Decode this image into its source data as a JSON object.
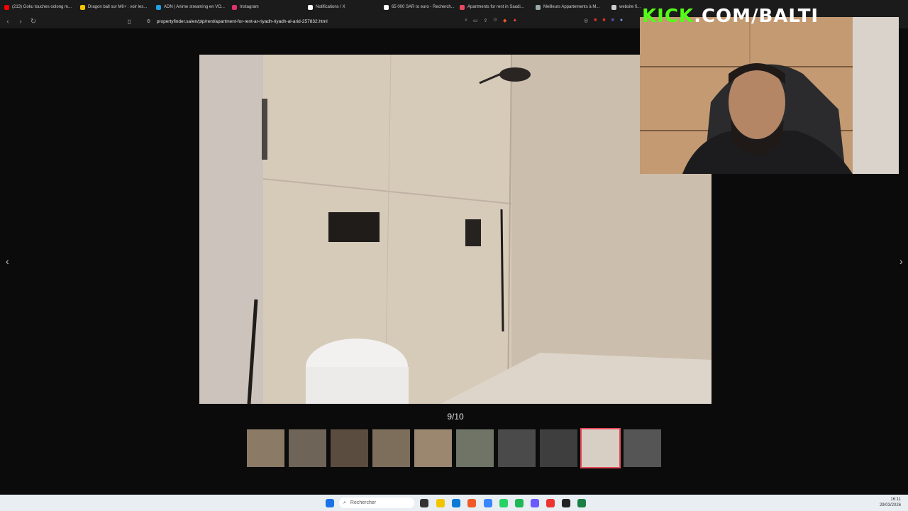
{
  "browser": {
    "tabs": [
      {
        "label": "(213) Goku touches oolong m...",
        "icon": "youtube-icon",
        "color": "#ff0000"
      },
      {
        "label": "Dragon ball sur M6+ : voir les...",
        "icon": "star-icon",
        "color": "#f5c400"
      },
      {
        "label": "ADN | Anime streaming en VO...",
        "icon": "adn-icon",
        "color": "#1ea0e5"
      },
      {
        "label": "Instagram",
        "icon": "instagram-icon",
        "color": "#e1306c"
      },
      {
        "label": "Notifications / X",
        "icon": "x-icon",
        "color": "#ffffff"
      },
      {
        "label": "65 000 SAR to euro - Recherch...",
        "icon": "google-icon",
        "color": "#ffffff"
      },
      {
        "label": "Apartments for rent in Saudi...",
        "icon": "propertyfinder-icon",
        "color": "#e84a5f"
      },
      {
        "label": "Meilleurs Appartements à M...",
        "icon": "airbnb-icon",
        "color": "#9aa"
      },
      {
        "label": "website fi...",
        "icon": "globe-icon",
        "color": "#cccccc"
      }
    ],
    "url": "propertyfinder.sa/en/plp/rent/apartment-for-rent-ar-riyadh-riyadh-al-arid-257832.html"
  },
  "gallery": {
    "counter": "9/10",
    "thumbnail_count": 10,
    "active_index": 8,
    "prev_label": "‹",
    "next_label": "›"
  },
  "overlay": {
    "brand": "KICK",
    "handle": ".COM/BALTI"
  },
  "taskbar": {
    "search_placeholder": "Rechercher",
    "time": "16:11",
    "date": "29/03/2026"
  }
}
